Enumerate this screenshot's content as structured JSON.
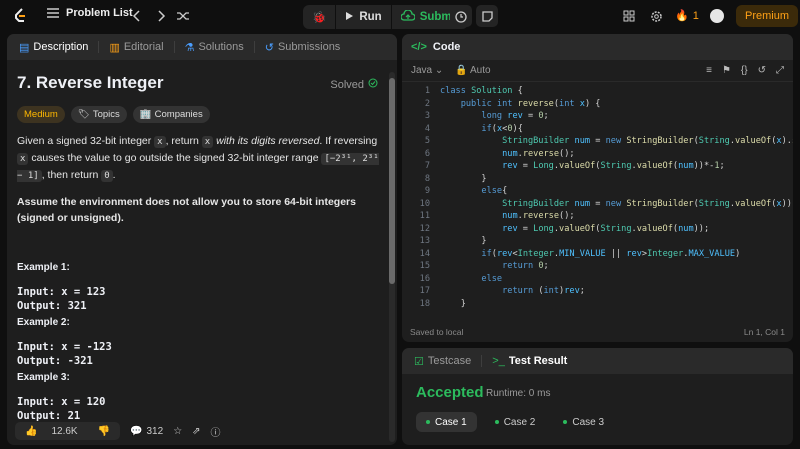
{
  "topbar": {
    "problem_list": "Problem List",
    "run": "Run",
    "submit": "Submit",
    "streak": "1",
    "premium": "Premium"
  },
  "left": {
    "tabs": [
      "Description",
      "Editorial",
      "Solutions",
      "Submissions"
    ],
    "title": "7. Reverse Integer",
    "solved": "Solved",
    "chips": [
      "Medium",
      "Topics",
      "Companies"
    ],
    "para1_a": "Given a signed 32-bit integer ",
    "para1_x": "x",
    "para1_b": ", return ",
    "para1_x2": "x",
    "para1_c": " with its digits reversed",
    "para1_d": ". If reversing ",
    "para1_x3": "x",
    "para1_e": " causes the value to go outside the signed 32-bit integer range ",
    "para1_range": "[−2³¹, 2³¹ − 1]",
    "para1_f": ", then return ",
    "para1_zero": "0",
    "para1_g": ".",
    "para2": "Assume the environment does not allow you to store 64-bit integers (signed or unsigned).",
    "examples": [
      {
        "label": "Example 1:",
        "input": "Input: x = 123",
        "output": "Output: 321"
      },
      {
        "label": "Example 2:",
        "input": "Input: x = -123",
        "output": "Output: -321"
      },
      {
        "label": "Example 3:",
        "input": "Input: x = 120",
        "output": "Output: 21"
      }
    ],
    "likes": "12.6K",
    "comments": "312"
  },
  "code": {
    "header": "Code",
    "lang": "Java",
    "auto": "Auto",
    "lines": [
      "1",
      "2",
      "3",
      "4",
      "5",
      "6",
      "7",
      "8",
      "9",
      "10",
      "11",
      "12",
      "13",
      "14",
      "15",
      "16",
      "17",
      "18"
    ],
    "saved": "Saved to local",
    "pos": "Ln 1, Col 1"
  },
  "result": {
    "tabs": [
      "Testcase",
      "Test Result"
    ],
    "status": "Accepted",
    "runtime": "Runtime: 0 ms",
    "cases": [
      "Case 1",
      "Case 2",
      "Case 3"
    ]
  }
}
